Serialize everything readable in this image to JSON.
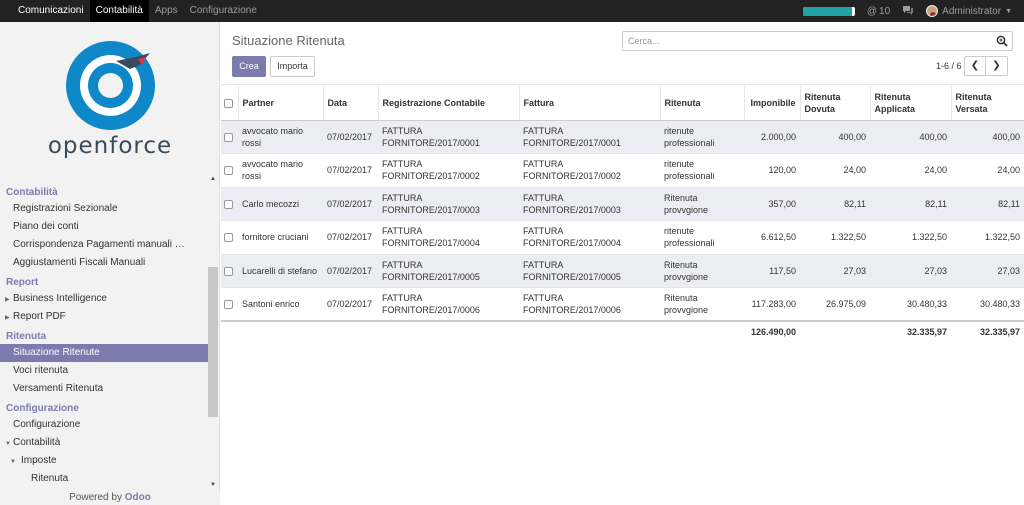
{
  "topbar": {
    "menu": [
      "Comunicazioni",
      "Contabilità",
      "Apps",
      "Configurazione"
    ],
    "active_index": 1,
    "progress": 0.95,
    "mentions_count": "10",
    "user_name": "Administrator"
  },
  "sidebar": {
    "logo_text": "openforce",
    "sections": [
      {
        "title": "Contabilità",
        "items": [
          "Registrazioni Sezionale",
          "Piano dei conti",
          "Corrispondenza Pagamenti manuali …",
          "Aggiustamenti Fiscali Manuali"
        ]
      },
      {
        "title": "Report",
        "items": [
          "Business Intelligence",
          "Report PDF"
        ]
      },
      {
        "title": "Ritenuta",
        "items": [
          "Situazione Ritenute",
          "Voci ritenuta",
          "Versamenti Ritenuta"
        ]
      },
      {
        "title": "Configurazione",
        "items": [
          "Configurazione",
          "Contabilità",
          "Imposte",
          "Ritenuta"
        ]
      }
    ],
    "powered_by": "Powered by",
    "powered_brand": "Odoo"
  },
  "control_panel": {
    "title": "Situazione Ritenuta",
    "create_label": "Crea",
    "import_label": "Importa",
    "search_placeholder": "Cerca...",
    "pager": "1-6 / 6"
  },
  "table": {
    "headers": [
      "Partner",
      "Data",
      "Registrazione Contabile",
      "Fattura",
      "Ritenuta",
      "Imponibile",
      "Ritenuta Dovuta",
      "Ritenuta Applicata",
      "Ritenuta Versata"
    ],
    "rows": [
      {
        "partner": "avvocato mario rossi",
        "data": "07/02/2017",
        "registrazione": "FATTURA FORNITORE/2017/0001",
        "fattura": "FATTURA FORNITORE/2017/0001",
        "ritenuta": "ritenute professionali",
        "imponibile": "2.000,00",
        "dovuta": "400,00",
        "applicata": "400,00",
        "versata": "400,00"
      },
      {
        "partner": "avvocato mario rossi",
        "data": "07/02/2017",
        "registrazione": "FATTURA FORNITORE/2017/0002",
        "fattura": "FATTURA FORNITORE/2017/0002",
        "ritenuta": "ritenute professionali",
        "imponibile": "120,00",
        "dovuta": "24,00",
        "applicata": "24,00",
        "versata": "24,00"
      },
      {
        "partner": "Carlo mecozzi",
        "data": "07/02/2017",
        "registrazione": "FATTURA FORNITORE/2017/0003",
        "fattura": "FATTURA FORNITORE/2017/0003",
        "ritenuta": "Ritenuta provvgione",
        "imponibile": "357,00",
        "dovuta": "82,11",
        "applicata": "82,11",
        "versata": "82,11"
      },
      {
        "partner": "fornitore cruciani",
        "data": "07/02/2017",
        "registrazione": "FATTURA FORNITORE/2017/0004",
        "fattura": "FATTURA FORNITORE/2017/0004",
        "ritenuta": "ritenute professionali",
        "imponibile": "6.612,50",
        "dovuta": "1.322,50",
        "applicata": "1.322,50",
        "versata": "1.322,50"
      },
      {
        "partner": "Lucarelli di stefano",
        "data": "07/02/2017",
        "registrazione": "FATTURA FORNITORE/2017/0005",
        "fattura": "FATTURA FORNITORE/2017/0005",
        "ritenuta": "Ritenuta provvgione",
        "imponibile": "117,50",
        "dovuta": "27,03",
        "applicata": "27,03",
        "versata": "27,03"
      },
      {
        "partner": "Santoni enrico",
        "data": "07/02/2017",
        "registrazione": "FATTURA FORNITORE/2017/0006",
        "fattura": "FATTURA FORNITORE/2017/0006",
        "ritenuta": "Ritenuta provvgione",
        "imponibile": "117.283,00",
        "dovuta": "26.975,09",
        "applicata": "30.480,33",
        "versata": "30.480,33"
      }
    ],
    "totals": {
      "imponibile": "126.490,00",
      "dovuta": "",
      "applicata": "32.335,97",
      "versata": "32.335,97"
    }
  },
  "colors": {
    "accent": "#7c7bad",
    "topbar": "#222222",
    "logo_blue": "#0e88c8"
  }
}
